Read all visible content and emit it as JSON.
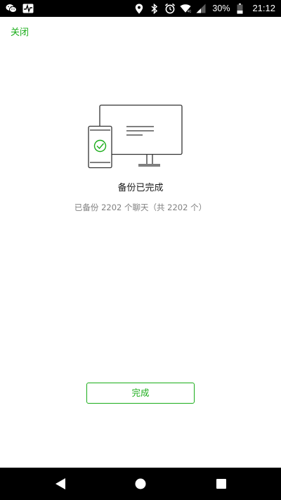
{
  "status_bar": {
    "left_icons": [
      "wechat-icon",
      "activity-monitor-icon"
    ],
    "right_icons": [
      "location-icon",
      "bluetooth-icon",
      "alarm-icon",
      "wifi-icon",
      "signal-icon",
      "battery-icon"
    ],
    "battery_percent": "30%",
    "time": "21:12"
  },
  "header": {
    "close_label": "关闭"
  },
  "main": {
    "illustration_icons": [
      "phone-icon",
      "checkmark-icon",
      "monitor-icon"
    ],
    "title": "备份已完成",
    "subtitle": "已备份 2202 个聊天（共 2202 个）",
    "done_label": "完成"
  },
  "nav_bar": {
    "icons": [
      "back-icon",
      "home-icon",
      "recents-icon"
    ]
  },
  "colors": {
    "accent": "#1aad19",
    "text_primary": "#1a1a1a",
    "text_secondary": "#808080",
    "bars": "#000000"
  }
}
